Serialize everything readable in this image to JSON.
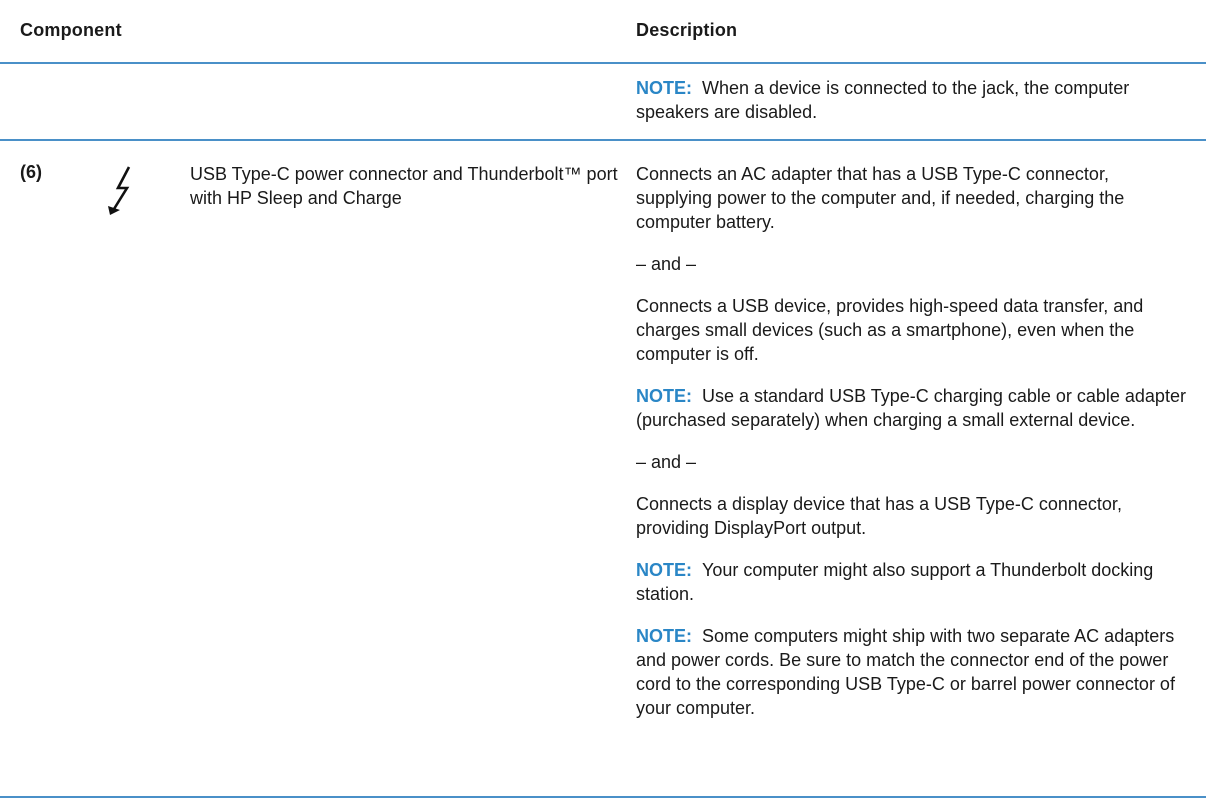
{
  "header": {
    "component": "Component",
    "description": "Description"
  },
  "continuation_row": {
    "note_label": "NOTE:",
    "note_text": "When a device is connected to the jack, the computer speakers are disabled."
  },
  "main_row": {
    "number": "(6)",
    "icon": "thunderbolt-bolt-icon",
    "component": "USB Type-C power connector and Thunderbolt™ port with HP Sleep and Charge",
    "paragraphs": [
      {
        "label": "",
        "text": "Connects an AC adapter that has a USB Type-C connector, supplying power to the computer and, if needed, charging the computer battery."
      },
      {
        "label": "",
        "text": "– and –"
      },
      {
        "label": "",
        "text": "Connects a USB device, provides high-speed data transfer, and charges small devices (such as a smartphone), even when the computer is off."
      },
      {
        "label": "NOTE:",
        "text": "Use a standard USB Type-C charging cable or cable adapter (purchased separately) when charging a small external device."
      },
      {
        "label": "",
        "text": "– and –"
      },
      {
        "label": "",
        "text": "Connects a display device that has a USB Type-C connector, providing DisplayPort output."
      },
      {
        "label": "NOTE:",
        "text": "Your computer might also support a Thunderbolt docking station."
      },
      {
        "label": "NOTE:",
        "text": "Some computers might ship with two separate AC adapters and power cords. Be sure to match the connector end of the power cord to the corresponding USB Type-C or barrel power connector of your computer."
      }
    ]
  },
  "colors": {
    "rule": "#4a90c8",
    "note": "#2a86c6",
    "text": "#1a1a1a"
  }
}
